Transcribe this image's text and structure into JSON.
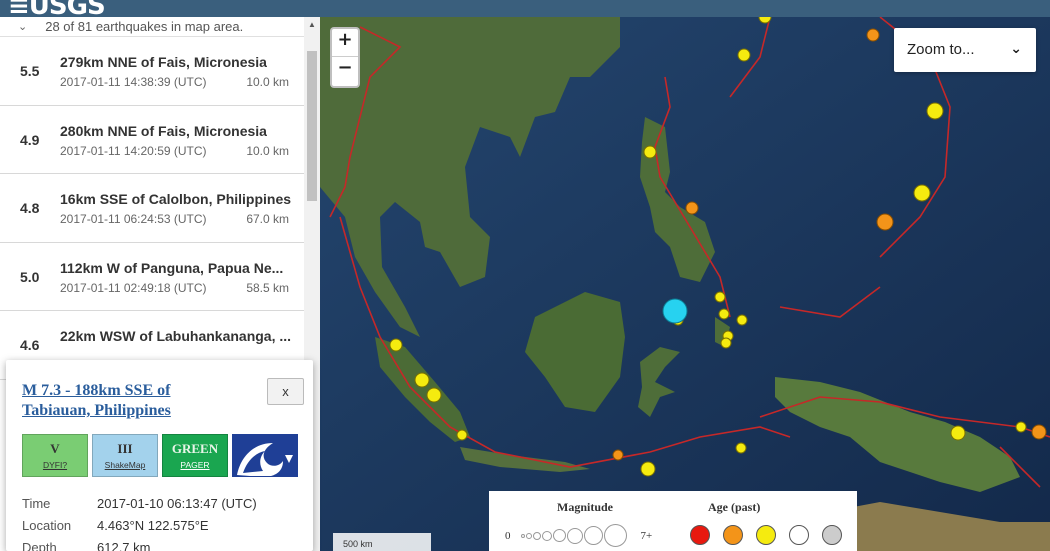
{
  "header": {
    "logo_text": "≡USGS"
  },
  "list": {
    "header_text": "28 of 81 earthquakes in map area.",
    "items": [
      {
        "mag": "5.5",
        "place": "279km NNE of Fais, Micronesia",
        "time": "2017-01-11 14:38:39 (UTC)",
        "depth": "10.0 km"
      },
      {
        "mag": "4.9",
        "place": "280km NNE of Fais, Micronesia",
        "time": "2017-01-11 14:20:59 (UTC)",
        "depth": "10.0 km"
      },
      {
        "mag": "4.8",
        "place": "16km SSE of Calolbon, Philippines",
        "time": "2017-01-11 06:24:53 (UTC)",
        "depth": "67.0 km"
      },
      {
        "mag": "5.0",
        "place": "112km W of Panguna, Papua Ne...",
        "time": "2017-01-11 02:49:18 (UTC)",
        "depth": "58.5 km"
      },
      {
        "mag": "4.6",
        "place": "22km WSW of Labuhankananga, ...",
        "time": "",
        "depth": ""
      }
    ]
  },
  "map_controls": {
    "zoom_in": "+",
    "zoom_out": "−",
    "zoom_to_label": "Zoom to...",
    "scale_label": "500 km"
  },
  "legend": {
    "magnitude_title": "Magnitude",
    "age_title": "Age (past)",
    "mag_min": "0",
    "mag_max": "7+",
    "age_colors": [
      "#e8190f",
      "#f39419",
      "#f5eb0f",
      "#ffffff",
      "#cccccc"
    ]
  },
  "popup": {
    "title": "M 7.3 - 188km SSE of Tabiauan, Philippines",
    "close": "x",
    "dyfi_value": "V",
    "dyfi_label": "DYFI?",
    "shakemap_value": "III",
    "shakemap_label": "ShakeMap",
    "pager_value": "GREEN",
    "pager_label": "PAGER",
    "tsunami_icon": "tsunami-icon",
    "time_label": "Time",
    "time_value": "2017-01-10 06:13:47 (UTC)",
    "location_label": "Location",
    "location_value": "4.463°N 122.575°E",
    "depth_label": "Depth",
    "depth_value": "612.7 km"
  },
  "colors": {
    "header": "#3a5f7d",
    "quake_orange": "#f39419",
    "quake_yellow": "#f5eb0f",
    "quake_selected": "#27d2f0",
    "plate_boundary": "#c62828"
  }
}
